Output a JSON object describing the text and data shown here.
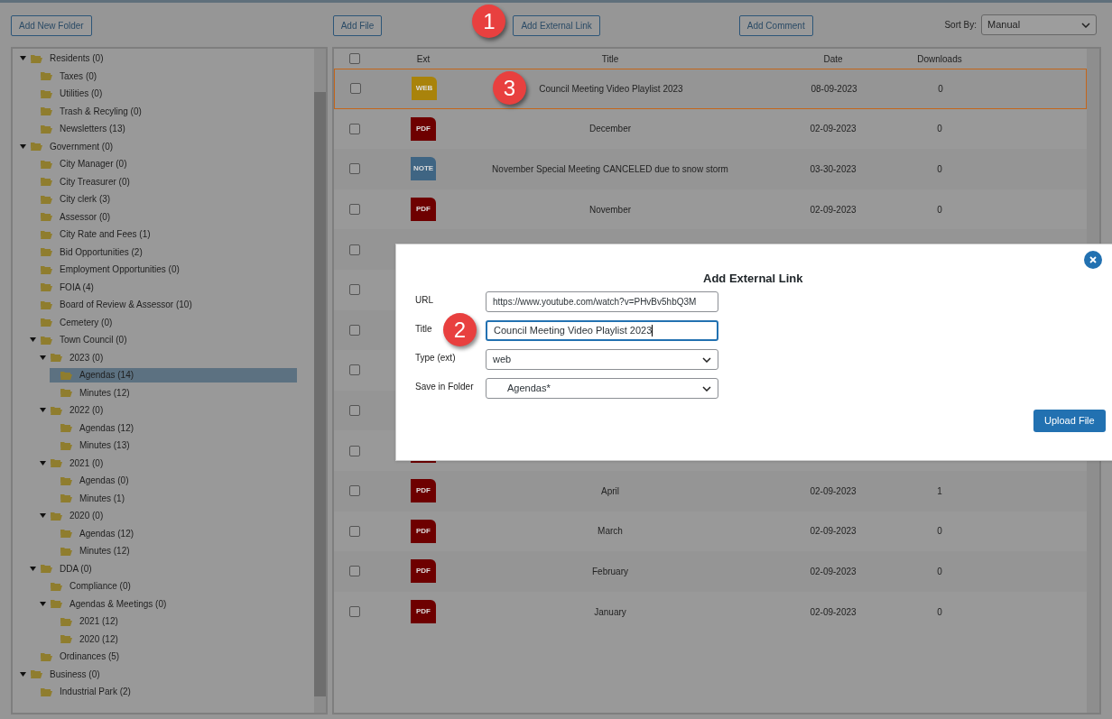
{
  "toolbar": {
    "buttons": [
      {
        "label": "Add New Folder"
      },
      {
        "label": "Add File"
      },
      {
        "label": "Add External Link",
        "callout": "1"
      },
      {
        "label": "Add Comment"
      }
    ],
    "sort_label": "Sort By:",
    "sort_value": "Manual"
  },
  "folders": [
    {
      "label": "Residents (0)",
      "expanded": true,
      "selected": false,
      "children": [
        {
          "label": "Taxes (0)",
          "selected": false
        },
        {
          "label": "Utilities (0)",
          "selected": false
        },
        {
          "label": "Trash & Recyling (0)",
          "selected": false
        },
        {
          "label": "Newsletters (13)",
          "selected": false
        }
      ]
    },
    {
      "label": "Government (0)",
      "expanded": true,
      "selected": false,
      "children": [
        {
          "label": "City Manager (0)",
          "selected": false
        },
        {
          "label": "City Treasurer (0)",
          "selected": false
        },
        {
          "label": "City clerk (3)",
          "selected": false
        },
        {
          "label": "Assessor (0)",
          "selected": false
        },
        {
          "label": "City Rate and Fees (1)",
          "selected": false
        },
        {
          "label": "Bid Opportunities (2)",
          "selected": false
        },
        {
          "label": "Employment Opportunities (0)",
          "selected": false
        },
        {
          "label": "FOIA (4)",
          "selected": false
        },
        {
          "label": "Board of Review & Assessor (10)",
          "selected": false
        },
        {
          "label": "Cemetery (0)",
          "selected": false
        },
        {
          "label": "Town Council (0)",
          "expanded": true,
          "selected": false,
          "children": [
            {
              "label": "2023 (0)",
              "expanded": true,
              "selected": false,
              "children": [
                {
                  "label": "Agendas (14)",
                  "selected": true
                },
                {
                  "label": "Minutes (12)",
                  "selected": false
                }
              ]
            },
            {
              "label": "2022 (0)",
              "expanded": true,
              "selected": false,
              "children": [
                {
                  "label": "Agendas (12)",
                  "selected": false
                },
                {
                  "label": "Minutes (13)",
                  "selected": false
                }
              ]
            },
            {
              "label": "2021 (0)",
              "expanded": true,
              "selected": false,
              "children": [
                {
                  "label": "Agendas (0)",
                  "selected": false
                },
                {
                  "label": "Minutes (1)",
                  "selected": false
                }
              ]
            },
            {
              "label": "2020 (0)",
              "expanded": true,
              "selected": false,
              "children": [
                {
                  "label": "Agendas (12)",
                  "selected": false
                },
                {
                  "label": "Minutes (12)",
                  "selected": false
                }
              ]
            }
          ]
        },
        {
          "label": "DDA (0)",
          "expanded": true,
          "selected": false,
          "children": [
            {
              "label": "Compliance (0)",
              "selected": false
            },
            {
              "label": "Agendas & Meetings (0)",
              "expanded": true,
              "selected": false,
              "children": [
                {
                  "label": "2021 (12)",
                  "selected": false
                },
                {
                  "label": "2020 (12)",
                  "selected": false
                }
              ]
            }
          ]
        },
        {
          "label": "Ordinances (5)",
          "selected": false
        }
      ]
    },
    {
      "label": "Business (0)",
      "expanded": true,
      "selected": false,
      "children": [
        {
          "label": "Industrial Park (2)",
          "selected": false
        }
      ]
    }
  ],
  "table": {
    "columns": [
      "Ext",
      "Title",
      "Date",
      "Downloads"
    ],
    "header_checked": false,
    "rows": [
      {
        "checked": false,
        "highlighted": true,
        "callout": "3",
        "ext": {
          "kind": "web",
          "label": "WEB"
        },
        "title": "Council Meeting Video Playlist 2023",
        "date": "08-09-2023",
        "downloads": "0"
      },
      {
        "checked": false,
        "highlighted": false,
        "ext": {
          "kind": "pdf",
          "label": "PDF"
        },
        "title": "December",
        "date": "02-09-2023",
        "downloads": "0"
      },
      {
        "checked": false,
        "highlighted": false,
        "ext": {
          "kind": "note",
          "label": "NOTE"
        },
        "title": "November Special Meeting CANCELED due to snow storm",
        "date": "03-30-2023",
        "downloads": "0"
      },
      {
        "checked": false,
        "highlighted": false,
        "ext": {
          "kind": "pdf",
          "label": "PDF"
        },
        "title": "November",
        "date": "02-09-2023",
        "downloads": "0"
      },
      {
        "checked": false,
        "highlighted": false
      },
      {
        "checked": false,
        "highlighted": false
      },
      {
        "checked": false,
        "highlighted": false
      },
      {
        "checked": false,
        "highlighted": false
      },
      {
        "checked": false,
        "highlighted": false
      },
      {
        "checked": false,
        "highlighted": false,
        "ext": {
          "kind": "pdf"
        }
      },
      {
        "checked": false,
        "highlighted": false,
        "ext": {
          "kind": "pdf",
          "label": "PDF"
        },
        "title": "April",
        "date": "02-09-2023",
        "downloads": "1"
      },
      {
        "checked": false,
        "highlighted": false,
        "ext": {
          "kind": "pdf",
          "label": "PDF"
        },
        "title": "March",
        "date": "02-09-2023",
        "downloads": "0"
      },
      {
        "checked": false,
        "highlighted": false,
        "ext": {
          "kind": "pdf",
          "label": "PDF"
        },
        "title": "February",
        "date": "02-09-2023",
        "downloads": "0"
      },
      {
        "checked": false,
        "highlighted": false,
        "ext": {
          "kind": "pdf",
          "label": "PDF"
        },
        "title": "January",
        "date": "02-09-2023",
        "downloads": "0"
      }
    ]
  },
  "dialog": {
    "title": "Add External Link",
    "fields": [
      {
        "kind": "text",
        "label": "URL",
        "value": "https://www.youtube.com/watch?v=PHvBv5hbQ3M",
        "focused": false
      },
      {
        "kind": "text",
        "label": "Title",
        "value": "Council Meeting Video Playlist 2023",
        "focused": true,
        "callout": "2"
      },
      {
        "kind": "select",
        "label": "Type (ext)",
        "value": "web",
        "focused": false
      },
      {
        "kind": "select",
        "label": "Save in Folder",
        "value": "Agendas*",
        "focused": false
      }
    ],
    "submit": "Upload File"
  }
}
